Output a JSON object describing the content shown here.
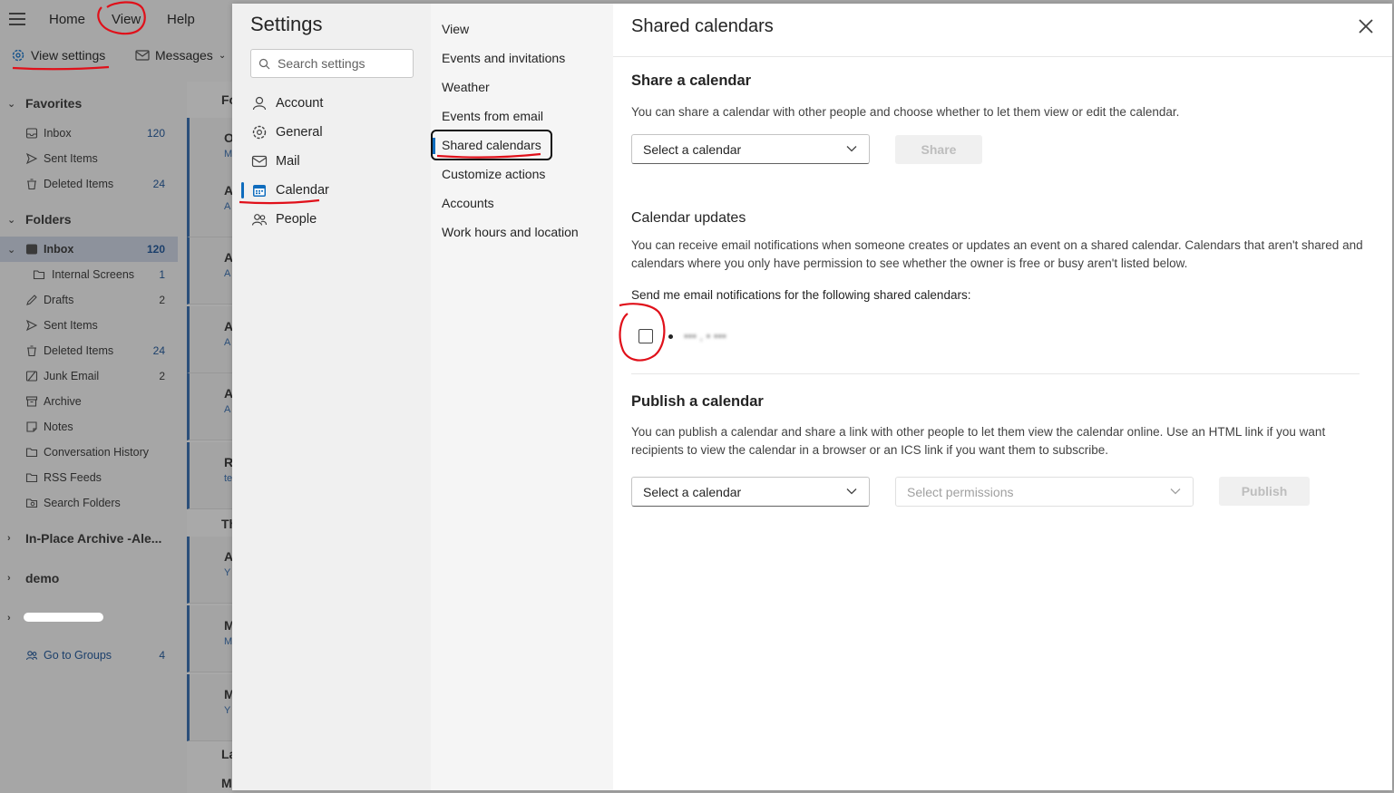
{
  "app": {
    "menu_tabs": [
      "Home",
      "View",
      "Help"
    ],
    "toolbar": {
      "view_settings": "View settings",
      "messages": "Messages"
    },
    "favorites": {
      "label": "Favorites",
      "items": [
        {
          "label": "Inbox",
          "count": "120",
          "icon": "inbox-icon"
        },
        {
          "label": "Sent Items",
          "count": "",
          "icon": "send-icon"
        },
        {
          "label": "Deleted Items",
          "count": "24",
          "icon": "trash-icon"
        }
      ]
    },
    "folders": {
      "label": "Folders",
      "items": [
        {
          "label": "Inbox",
          "count": "120",
          "icon": "inbox-icon"
        },
        {
          "label": "Internal Screens",
          "count": "1",
          "icon": "folder-icon"
        },
        {
          "label": "Drafts",
          "count": "2",
          "icon": "pencil-icon"
        },
        {
          "label": "Sent Items",
          "count": "",
          "icon": "send-icon"
        },
        {
          "label": "Deleted Items",
          "count": "24",
          "icon": "trash-icon"
        },
        {
          "label": "Junk Email",
          "count": "2",
          "icon": "junk-icon"
        },
        {
          "label": "Archive",
          "count": "",
          "icon": "archive-icon"
        },
        {
          "label": "Notes",
          "count": "",
          "icon": "notes-icon"
        },
        {
          "label": "Conversation History",
          "count": "",
          "icon": "folder-icon"
        },
        {
          "label": "RSS Feeds",
          "count": "",
          "icon": "folder-icon"
        },
        {
          "label": "Search Folders",
          "count": "",
          "icon": "search-folder-icon"
        }
      ]
    },
    "accounts": [
      "In-Place Archive -Ale...",
      "demo"
    ],
    "go_to_groups": {
      "label": "Go to Groups",
      "count": "4"
    },
    "mail_letters": [
      "O",
      "A",
      "A",
      "A",
      "A",
      "R",
      "A",
      "M",
      "M",
      "M"
    ],
    "mail_subs": [
      "M",
      "A",
      "A",
      "A",
      "A",
      "te",
      "Y",
      "M",
      "Y",
      "M"
    ],
    "mail_headers": [
      "Fo",
      "Th",
      "La"
    ]
  },
  "settings": {
    "title": "Settings",
    "search": {
      "placeholder": "Search settings"
    },
    "categories": [
      {
        "label": "Account",
        "icon": "person-icon"
      },
      {
        "label": "General",
        "icon": "gear-icon"
      },
      {
        "label": "Mail",
        "icon": "mail-icon"
      },
      {
        "label": "Calendar",
        "icon": "calendar-icon"
      },
      {
        "label": "People",
        "icon": "people-icon"
      }
    ],
    "subcategories": [
      "View",
      "Events and invitations",
      "Weather",
      "Events from email",
      "Shared calendars",
      "Customize actions",
      "Accounts",
      "Work hours and location"
    ],
    "page": {
      "title": "Shared calendars",
      "share": {
        "heading": "Share a calendar",
        "description": "You can share a calendar with other people and choose whether to let them view or edit the calendar.",
        "select_placeholder": "Select a calendar",
        "button": "Share"
      },
      "updates": {
        "heading": "Calendar updates",
        "description": "You can receive email notifications when someone creates or updates an event on a shared calendar. Calendars that aren't shared and calendars where you only have permission to see whether the owner is free or busy aren't listed below.",
        "prompt": "Send me email notifications for the following shared calendars:"
      },
      "publish": {
        "heading": "Publish a calendar",
        "description": "You can publish a calendar and share a link with other people to let them view the calendar online. Use an HTML link if you want recipients to view the calendar in a browser or an ICS link if you want them to subscribe.",
        "select_calendar": "Select a calendar",
        "select_permissions": "Select permissions",
        "button": "Publish"
      }
    }
  },
  "colors": {
    "accent": "#0f6cbd",
    "annotation": "#e0101a",
    "dim_overlay": "#a6a6a6"
  }
}
